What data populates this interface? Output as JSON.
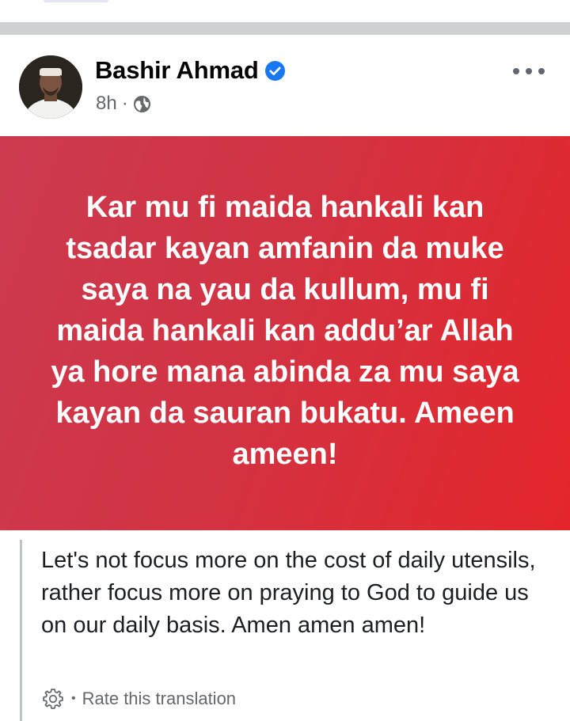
{
  "post": {
    "author": "Bashir Ahmad",
    "timestamp": "8h",
    "separator": "·",
    "audience_icon": "globe-icon",
    "verified_icon": "verified-badge-icon",
    "more_icon": "more-options-icon"
  },
  "banner": {
    "text": "Kar mu fi maida hankali kan tsadar kayan amfanin da muke saya na yau da kullum, mu fi maida hankali kan addu’ar Allah ya hore mana abinda za mu saya kayan da sauran bukatu. Ameen ameen!",
    "gradient_start": "#cc3a4f",
    "gradient_end": "#e4262b"
  },
  "translation": {
    "text": "Let's not focus more on the cost of daily utensils, rather focus more on praying to God to guide us on our daily basis. Amen amen amen!",
    "rate_label": "Rate this translation",
    "separator": "•",
    "settings_icon": "gear-icon"
  },
  "colors": {
    "verified": "#1877f2",
    "divider": "#ced0d4",
    "secondary_text": "#65676b"
  }
}
